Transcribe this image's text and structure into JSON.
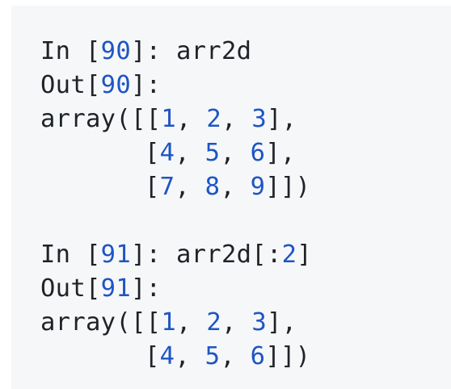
{
  "cells": [
    {
      "in_prefix": "In [",
      "in_number": "90",
      "in_suffix": "]: ",
      "in_code": "arr2d",
      "in_slice_open": "",
      "in_slice_num": "",
      "in_slice_close": "",
      "out_prefix": "Out[",
      "out_number": "90",
      "out_suffix": "]:",
      "output_rows": [
        {
          "lead": "array([[",
          "a": "1",
          "b": "2",
          "c": "3",
          "tail": "],"
        },
        {
          "lead": "[",
          "a": "4",
          "b": "5",
          "c": "6",
          "tail": "],"
        },
        {
          "lead": "[",
          "a": "7",
          "b": "8",
          "c": "9",
          "tail": "]])"
        }
      ]
    },
    {
      "in_prefix": "In [",
      "in_number": "91",
      "in_suffix": "]: ",
      "in_code": "arr2d[:",
      "in_slice_num": "2",
      "in_slice_close": "]",
      "out_prefix": "Out[",
      "out_number": "91",
      "out_suffix": "]:",
      "output_rows": [
        {
          "lead": "array([[",
          "a": "1",
          "b": "2",
          "c": "3",
          "tail": "],"
        },
        {
          "lead": "[",
          "a": "4",
          "b": "5",
          "c": "6",
          "tail": "]])"
        }
      ]
    }
  ],
  "separator": ", ",
  "colors": {
    "panel_bg": "#f6f7f9",
    "text": "#1f2328",
    "number": "#1d55c4"
  }
}
